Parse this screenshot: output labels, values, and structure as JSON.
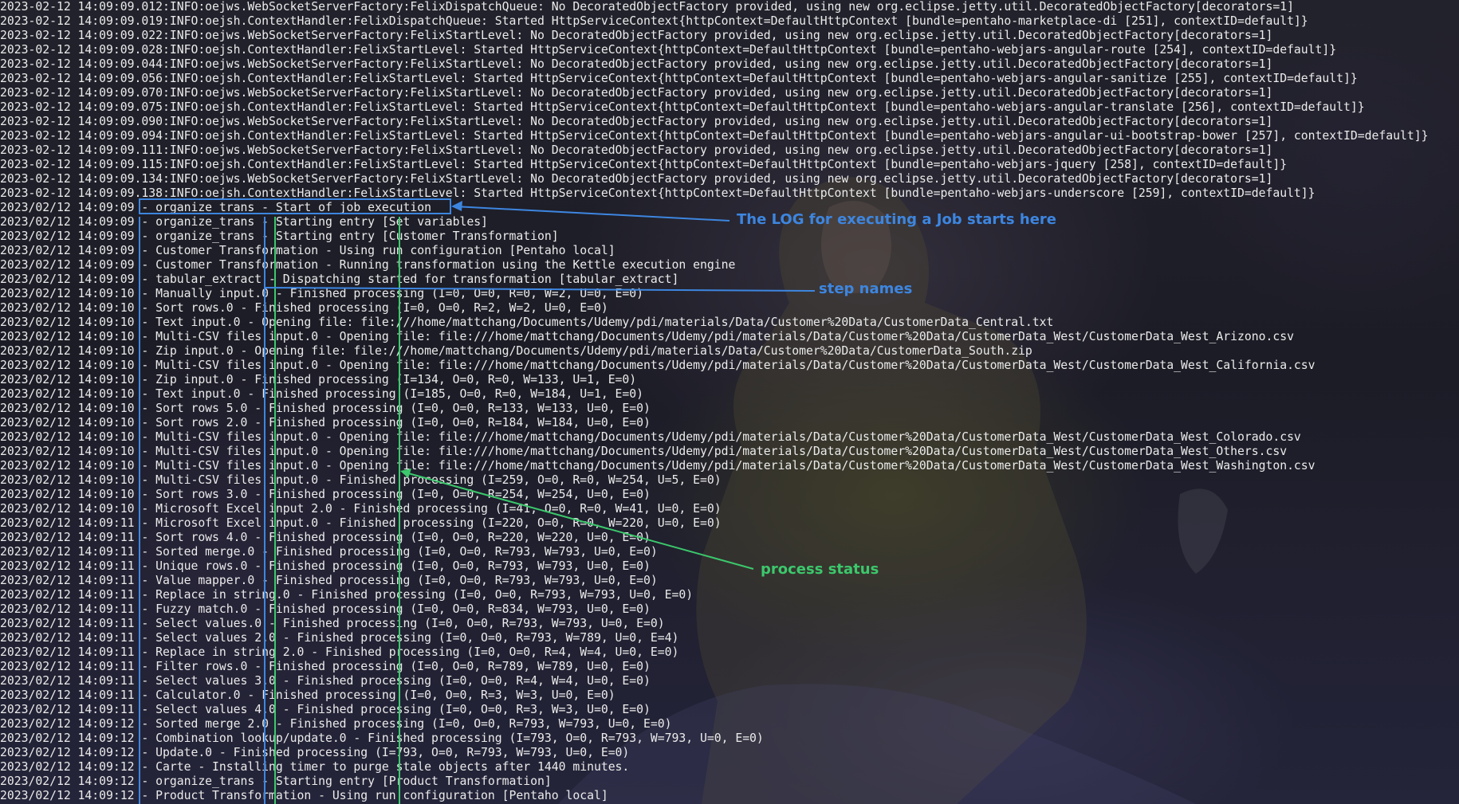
{
  "terminal": {
    "lines": [
      "2023-02-12 14:09:09.012:INFO:oejws.WebSocketServerFactory:FelixDispatchQueue: No DecoratedObjectFactory provided, using new org.eclipse.jetty.util.DecoratedObjectFactory[decorators=1]",
      "2023-02-12 14:09:09.019:INFO:oejsh.ContextHandler:FelixDispatchQueue: Started HttpServiceContext{httpContext=DefaultHttpContext [bundle=pentaho-marketplace-di [251], contextID=default]}",
      "2023-02-12 14:09:09.022:INFO:oejws.WebSocketServerFactory:FelixStartLevel: No DecoratedObjectFactory provided, using new org.eclipse.jetty.util.DecoratedObjectFactory[decorators=1]",
      "2023-02-12 14:09:09.028:INFO:oejsh.ContextHandler:FelixStartLevel: Started HttpServiceContext{httpContext=DefaultHttpContext [bundle=pentaho-webjars-angular-route [254], contextID=default]}",
      "2023-02-12 14:09:09.044:INFO:oejws.WebSocketServerFactory:FelixStartLevel: No DecoratedObjectFactory provided, using new org.eclipse.jetty.util.DecoratedObjectFactory[decorators=1]",
      "2023-02-12 14:09:09.056:INFO:oejsh.ContextHandler:FelixStartLevel: Started HttpServiceContext{httpContext=DefaultHttpContext [bundle=pentaho-webjars-angular-sanitize [255], contextID=default]}",
      "2023-02-12 14:09:09.070:INFO:oejws.WebSocketServerFactory:FelixStartLevel: No DecoratedObjectFactory provided, using new org.eclipse.jetty.util.DecoratedObjectFactory[decorators=1]",
      "2023-02-12 14:09:09.075:INFO:oejsh.ContextHandler:FelixStartLevel: Started HttpServiceContext{httpContext=DefaultHttpContext [bundle=pentaho-webjars-angular-translate [256], contextID=default]}",
      "2023-02-12 14:09:09.090:INFO:oejws.WebSocketServerFactory:FelixStartLevel: No DecoratedObjectFactory provided, using new org.eclipse.jetty.util.DecoratedObjectFactory[decorators=1]",
      "2023-02-12 14:09:09.094:INFO:oejsh.ContextHandler:FelixStartLevel: Started HttpServiceContext{httpContext=DefaultHttpContext [bundle=pentaho-webjars-angular-ui-bootstrap-bower [257], contextID=default]}",
      "2023-02-12 14:09:09.111:INFO:oejws.WebSocketServerFactory:FelixStartLevel: No DecoratedObjectFactory provided, using new org.eclipse.jetty.util.DecoratedObjectFactory[decorators=1]",
      "2023-02-12 14:09:09.115:INFO:oejsh.ContextHandler:FelixStartLevel: Started HttpServiceContext{httpContext=DefaultHttpContext [bundle=pentaho-webjars-jquery [258], contextID=default]}",
      "2023-02-12 14:09:09.134:INFO:oejws.WebSocketServerFactory:FelixStartLevel: No DecoratedObjectFactory provided, using new org.eclipse.jetty.util.DecoratedObjectFactory[decorators=1]",
      "2023-02-12 14:09:09.138:INFO:oejsh.ContextHandler:FelixStartLevel: Started HttpServiceContext{httpContext=DefaultHttpContext [bundle=pentaho-webjars-underscore [259], contextID=default]}",
      "2023/02/12 14:09:09 - organize_trans - Start of job execution",
      "2023/02/12 14:09:09 - organize_trans - Starting entry [Set variables]",
      "2023/02/12 14:09:09 - organize_trans - Starting entry [Customer Transformation]",
      "2023/02/12 14:09:09 - Customer Transformation - Using run configuration [Pentaho local]",
      "2023/02/12 14:09:09 - Customer Transformation - Running transformation using the Kettle execution engine",
      "2023/02/12 14:09:09 - tabular_extract - Dispatching started for transformation [tabular_extract]",
      "2023/02/12 14:09:10 - Manually input.0 - Finished processing (I=0, O=0, R=0, W=2, U=0, E=0)",
      "2023/02/12 14:09:10 - Sort rows.0 - Finished processing (I=0, O=0, R=2, W=2, U=0, E=0)",
      "2023/02/12 14:09:10 - Text input.0 - Opening file: file:///home/mattchang/Documents/Udemy/pdi/materials/Data/Customer%20Data/CustomerData_Central.txt",
      "2023/02/12 14:09:10 - Multi-CSV files input.0 - Opening file: file:///home/mattchang/Documents/Udemy/pdi/materials/Data/Customer%20Data/CustomerData_West/CustomerData_West_Arizono.csv",
      "2023/02/12 14:09:10 - Zip input.0 - Opening file: file:///home/mattchang/Documents/Udemy/pdi/materials/Data/Customer%20Data/CustomerData_South.zip",
      "2023/02/12 14:09:10 - Multi-CSV files input.0 - Opening file: file:///home/mattchang/Documents/Udemy/pdi/materials/Data/Customer%20Data/CustomerData_West/CustomerData_West_California.csv",
      "2023/02/12 14:09:10 - Zip input.0 - Finished processing (I=134, O=0, R=0, W=133, U=1, E=0)",
      "2023/02/12 14:09:10 - Text input.0 - Finished processing (I=185, O=0, R=0, W=184, U=1, E=0)",
      "2023/02/12 14:09:10 - Sort rows 5.0 - Finished processing (I=0, O=0, R=133, W=133, U=0, E=0)",
      "2023/02/12 14:09:10 - Sort rows 2.0 - Finished processing (I=0, O=0, R=184, W=184, U=0, E=0)",
      "2023/02/12 14:09:10 - Multi-CSV files input.0 - Opening file: file:///home/mattchang/Documents/Udemy/pdi/materials/Data/Customer%20Data/CustomerData_West/CustomerData_West_Colorado.csv",
      "2023/02/12 14:09:10 - Multi-CSV files input.0 - Opening file: file:///home/mattchang/Documents/Udemy/pdi/materials/Data/Customer%20Data/CustomerData_West/CustomerData_West_Others.csv",
      "2023/02/12 14:09:10 - Multi-CSV files input.0 - Opening file: file:///home/mattchang/Documents/Udemy/pdi/materials/Data/Customer%20Data/CustomerData_West/CustomerData_West_Washington.csv",
      "2023/02/12 14:09:10 - Multi-CSV files input.0 - Finished processing (I=259, O=0, R=0, W=254, U=5, E=0)",
      "2023/02/12 14:09:10 - Sort rows 3.0 - Finished processing (I=0, O=0, R=254, W=254, U=0, E=0)",
      "2023/02/12 14:09:10 - Microsoft Excel input 2.0 - Finished processing (I=41, O=0, R=0, W=41, U=0, E=0)",
      "2023/02/12 14:09:11 - Microsoft Excel input.0 - Finished processing (I=220, O=0, R=0, W=220, U=0, E=0)",
      "2023/02/12 14:09:11 - Sort rows 4.0 - Finished processing (I=0, O=0, R=220, W=220, U=0, E=0)",
      "2023/02/12 14:09:11 - Sorted merge.0 - Finished processing (I=0, O=0, R=793, W=793, U=0, E=0)",
      "2023/02/12 14:09:11 - Unique rows.0 - Finished processing (I=0, O=0, R=793, W=793, U=0, E=0)",
      "2023/02/12 14:09:11 - Value mapper.0 - Finished processing (I=0, O=0, R=793, W=793, U=0, E=0)",
      "2023/02/12 14:09:11 - Replace in string.0 - Finished processing (I=0, O=0, R=793, W=793, U=0, E=0)",
      "2023/02/12 14:09:11 - Fuzzy match.0 - Finished processing (I=0, O=0, R=834, W=793, U=0, E=0)",
      "2023/02/12 14:09:11 - Select values.0 - Finished processing (I=0, O=0, R=793, W=793, U=0, E=0)",
      "2023/02/12 14:09:11 - Select values 2.0 - Finished processing (I=0, O=0, R=793, W=789, U=0, E=4)",
      "2023/02/12 14:09:11 - Replace in string 2.0 - Finished processing (I=0, O=0, R=4, W=4, U=0, E=0)",
      "2023/02/12 14:09:11 - Filter rows.0 - Finished processing (I=0, O=0, R=789, W=789, U=0, E=0)",
      "2023/02/12 14:09:11 - Select values 3.0 - Finished processing (I=0, O=0, R=4, W=4, U=0, E=0)",
      "2023/02/12 14:09:11 - Calculator.0 - Finished processing (I=0, O=0, R=3, W=3, U=0, E=0)",
      "2023/02/12 14:09:11 - Select values 4.0 - Finished processing (I=0, O=0, R=3, W=3, U=0, E=0)",
      "2023/02/12 14:09:12 - Sorted merge 2.0 - Finished processing (I=0, O=0, R=793, W=793, U=0, E=0)",
      "2023/02/12 14:09:12 - Combination lookup/update.0 - Finished processing (I=793, O=0, R=793, W=793, U=0, E=0)",
      "2023/02/12 14:09:12 - Update.0 - Finished processing (I=793, O=0, R=793, W=793, U=0, E=0)",
      "2023/02/12 14:09:12 - Carte - Installing timer to purge stale objects after 1440 minutes.",
      "2023/02/12 14:09:12 - organize_trans - Starting entry [Product Transformation]",
      "2023/02/12 14:09:12 - Product Transformation - Using run configuration [Pentaho local]"
    ]
  },
  "annotations": {
    "job_start": "The LOG for executing a Job starts here",
    "step_names": "step names",
    "process_status": "process status"
  },
  "colors": {
    "text": "#ebebeb",
    "annotation_blue": "#3d86e0",
    "annotation_green": "#3cc86c",
    "background": "#1a1b25"
  }
}
